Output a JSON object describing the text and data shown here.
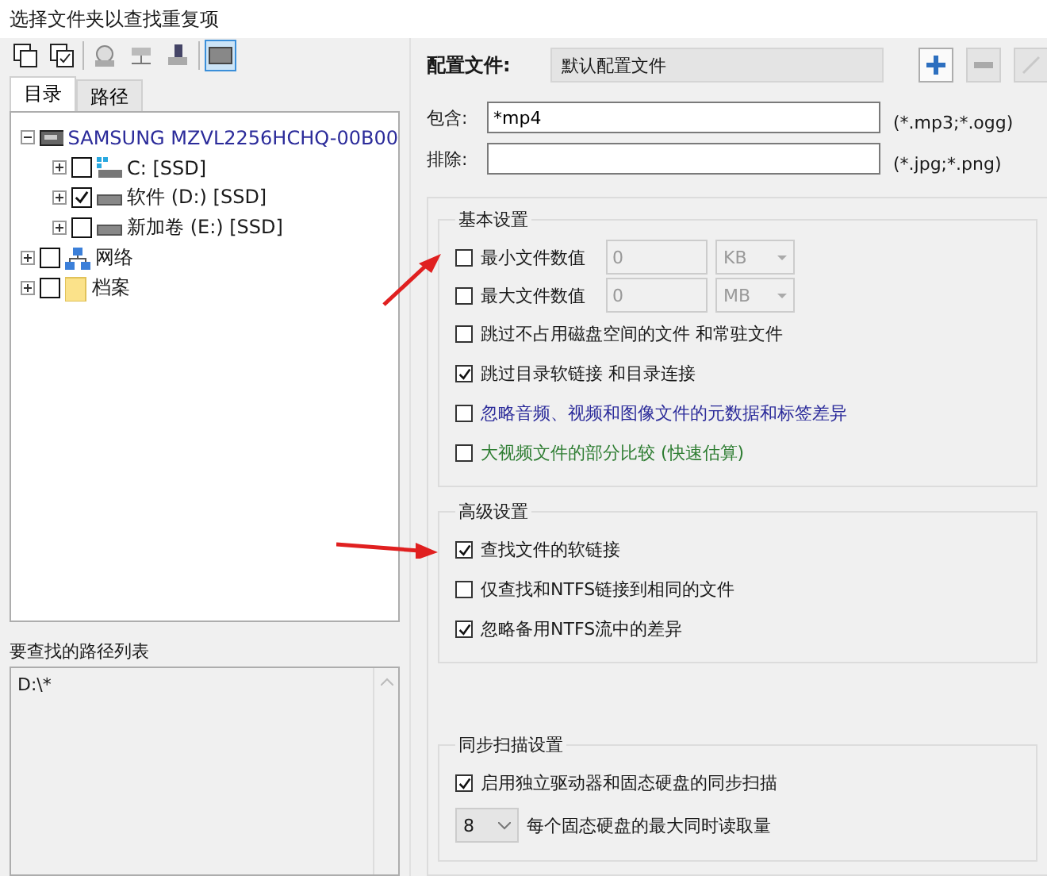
{
  "window": {
    "title": "选择文件夹以查找重复项"
  },
  "toolbar": [
    {
      "kind": "copy",
      "selected": false
    },
    {
      "kind": "copycheck",
      "selected": false
    },
    {
      "kind": "drive",
      "selected": false
    },
    {
      "kind": "network",
      "selected": false
    },
    {
      "kind": "usb",
      "selected": false
    },
    {
      "kind": "disk",
      "selected": true
    }
  ],
  "tabs": [
    {
      "label": "目录",
      "selected": true
    },
    {
      "label": "路径",
      "selected": false
    }
  ],
  "tree": [
    {
      "label": "SAMSUNG MZVL2256HCHQ-00B00",
      "kind": "disk",
      "expanded": true,
      "children": [
        {
          "label": "C: [SSD]",
          "kind": "system",
          "checked": false,
          "expanded": false
        },
        {
          "label": "软件 (D:) [SSD]",
          "kind": "drive",
          "checked": true,
          "expanded": false
        },
        {
          "label": "新加卷 (E:) [SSD]",
          "kind": "drive",
          "checked": false,
          "expanded": false
        }
      ]
    },
    {
      "label": "网络",
      "kind": "network",
      "checked": false,
      "expanded": false
    },
    {
      "label": "档案",
      "kind": "folder",
      "checked": false,
      "expanded": false
    }
  ],
  "path_list": {
    "label": "要查找的路径列表",
    "items": [
      "D:\\*"
    ]
  },
  "profile": {
    "label": "配置文件:",
    "value": "默认配置文件",
    "buttons": [
      {
        "kind": "add",
        "disabled": false
      },
      {
        "kind": "remove",
        "disabled": true
      },
      {
        "kind": "edit",
        "disabled": true
      }
    ]
  },
  "filters": [
    {
      "label": "包含:",
      "value": "*mp4",
      "hint": "(*.mp3;*.ogg)"
    },
    {
      "label": "排除:",
      "hint": "(*.jpg;*.png)"
    }
  ],
  "basic": {
    "title": "基本设置",
    "rows": [
      {
        "kind": "size",
        "label": "最小文件数值",
        "checked": false,
        "disabled": true,
        "value": "0",
        "unit": "KB"
      },
      {
        "kind": "size",
        "label": "最大文件数值",
        "checked": false,
        "disabled": true,
        "value": "0",
        "unit": "MB"
      },
      {
        "kind": "check",
        "label": "跳过不占用磁盘空间的文件 和常驻文件",
        "checked": false,
        "color": "#1a1a1a"
      },
      {
        "kind": "check",
        "label": "跳过目录软链接 和目录连接",
        "checked": true,
        "color": "#1a1a1a"
      },
      {
        "kind": "check",
        "label": "忽略音频、视频和图像文件的元数据和标签差异",
        "checked": false,
        "color": "#2b2b9a"
      },
      {
        "kind": "check",
        "label": "大视频文件的部分比较 (快速估算)",
        "checked": false,
        "color": "#2e7d32"
      }
    ]
  },
  "advanced": {
    "title": "高级设置",
    "rows": [
      {
        "label": "查找文件的软链接",
        "checked": true
      },
      {
        "label": "仅查找和NTFS链接到相同的文件",
        "checked": false
      },
      {
        "label": "忽略备用NTFS流中的差异",
        "checked": true
      }
    ]
  },
  "sync": {
    "title": "同步扫描设置",
    "check": {
      "label": "启用独立驱动器和固态硬盘的同步扫描",
      "checked": true
    },
    "count": "8",
    "count_label": "每个固态硬盘的最大同时读取量"
  }
}
